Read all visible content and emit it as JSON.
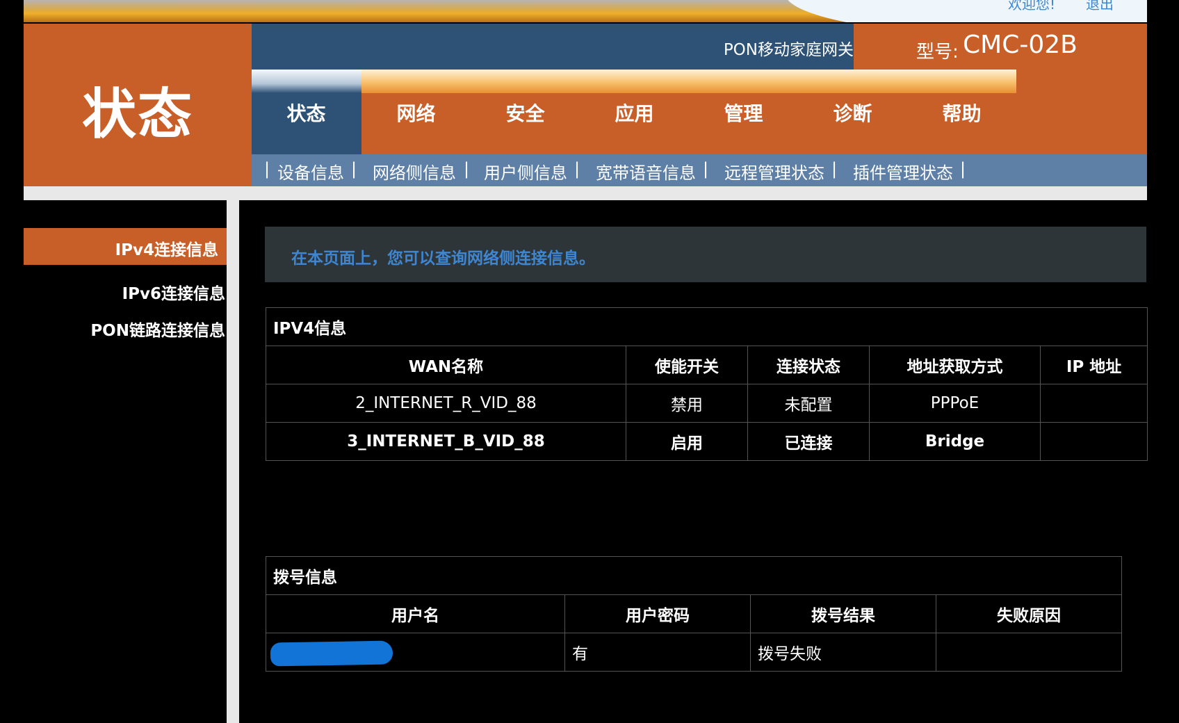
{
  "banner": {
    "welcome": "欢迎您!",
    "logout": "退出"
  },
  "header": {
    "page_title": "状态",
    "device_name": "PON移动家庭网关",
    "model_label": "型号:",
    "model_value": "CMC-02B"
  },
  "nav": {
    "items": [
      "状态",
      "网络",
      "安全",
      "应用",
      "管理",
      "诊断",
      "帮助"
    ],
    "active_index": 0
  },
  "subnav": {
    "items": [
      "设备信息",
      "网络侧信息",
      "用户侧信息",
      "宽带语音信息",
      "远程管理状态",
      "插件管理状态"
    ],
    "separator": "|"
  },
  "sidebar": {
    "items": [
      "IPv4连接信息",
      "IPv6连接信息",
      "PON链路连接信息"
    ],
    "active_index": 0
  },
  "info": {
    "text": "在本页面上，您可以查询网络侧连接信息。"
  },
  "ipv4_table": {
    "caption": "IPV4信息",
    "columns": [
      "WAN名称",
      "使能开关",
      "连接状态",
      "地址获取方式",
      "IP 地址"
    ],
    "rows": [
      [
        "2_INTERNET_R_VID_88",
        "禁用",
        "未配置",
        "PPPoE",
        ""
      ],
      [
        "3_INTERNET_B_VID_88",
        "启用",
        "已连接",
        "Bridge",
        ""
      ]
    ]
  },
  "dial_table": {
    "caption": "拨号信息",
    "columns": [
      "用户名",
      "用户密码",
      "拨号结果",
      "失败原因"
    ],
    "rows": [
      [
        "",
        "有",
        "拨号失败",
        ""
      ]
    ]
  },
  "colors": {
    "header_orange": "#c85f28",
    "header_blue": "#2d5276",
    "subnav_blue": "#5e7fa6",
    "link_blue": "#3f86d1",
    "info_bar": "#2e3539",
    "redaction_blue": "#1174d6"
  }
}
